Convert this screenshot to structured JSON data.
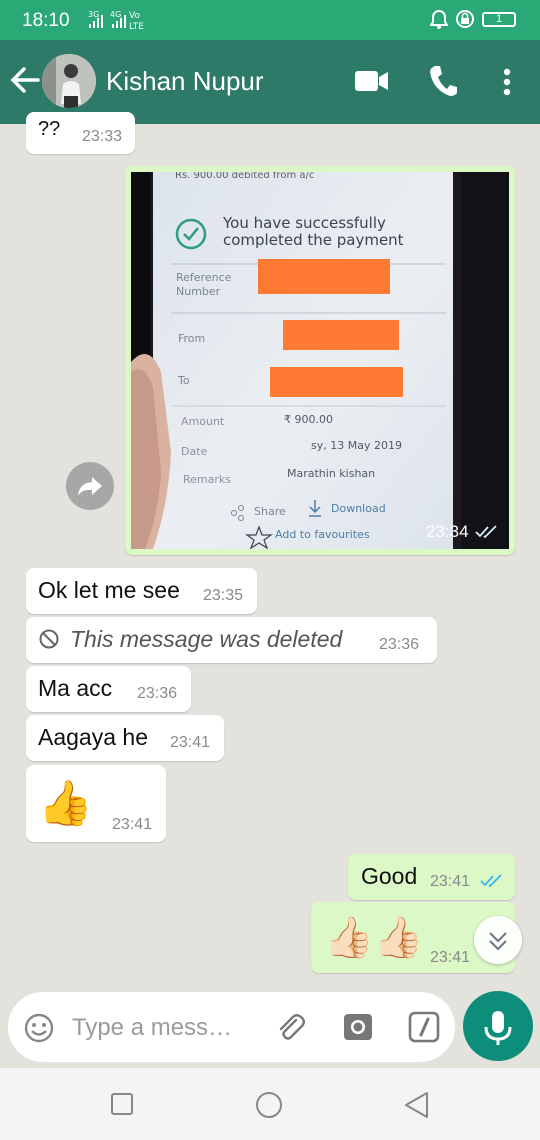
{
  "status": {
    "time": "18:10",
    "signal_text": "3G 4G Vo LTE",
    "battery": "1"
  },
  "header": {
    "contact_name": "Kishan Nupur"
  },
  "messages": {
    "m1": {
      "text": "??",
      "time": "23:33"
    },
    "image": {
      "time": "23:34",
      "top_text": "Rs. 900.00 debited from a/c",
      "success_line1": "You have successfully",
      "success_line2": "completed the payment",
      "ref_label1": "Reference",
      "ref_label2": "Number",
      "from_label": "From",
      "to_label": "To",
      "amount_label": "Amount",
      "amount_value": "₹ 900.00",
      "date_label": "Date",
      "date_value": "sy, 13 May 2019",
      "remarks_label": "Remarks",
      "remarks_value": "Marathin kishan",
      "share_label": "Share",
      "download_label": "Download",
      "fav_label": "Add to favourites"
    },
    "m2": {
      "text": "Ok let me see",
      "time": "23:35"
    },
    "m3": {
      "text": "This message was deleted",
      "time": "23:36"
    },
    "m4": {
      "text": "Ma acc",
      "time": "23:36"
    },
    "m5": {
      "text": "Aagaya he",
      "time": "23:41"
    },
    "m6": {
      "emoji": "👍",
      "time": "23:41"
    },
    "m7": {
      "text": "Good",
      "time": "23:41"
    },
    "m8": {
      "emoji": "👍🏻👍🏻",
      "time": "23:41"
    }
  },
  "composer": {
    "placeholder": "Type a mess…"
  }
}
